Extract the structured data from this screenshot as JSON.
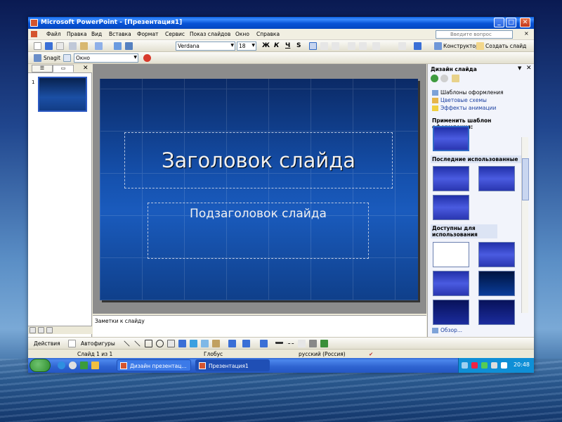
{
  "window": {
    "title": "Microsoft PowerPoint - [Презентация1]"
  },
  "menu": {
    "items": [
      "Файл",
      "Правка",
      "Вид",
      "Вставка",
      "Формат",
      "Сервис",
      "Показ слайдов",
      "Окно",
      "Справка"
    ],
    "help_placeholder": "Введите вопрос"
  },
  "toolbar": {
    "font": "Verdana",
    "size": "18",
    "bold": "Ж",
    "italic": "К",
    "underline": "Ч",
    "shadow": "S",
    "designer_label": "Конструктор",
    "new_slide_label": "Создать слайд",
    "snagit_label": "Snagit",
    "window_select": "Окно"
  },
  "slides_panel": {
    "slide_number": "1"
  },
  "slide": {
    "title": "Заголовок слайда",
    "subtitle": "Подзаголовок слайда"
  },
  "notes": {
    "placeholder": "Заметки к слайду"
  },
  "task_pane": {
    "title": "Дизайн слайда",
    "links": [
      "Шаблоны оформления",
      "Цветовые схемы",
      "Эффекты анимации"
    ],
    "apply_label": "Применить шаблон оформления:",
    "recent_label": "Последние использованные",
    "available_label": "Доступны для использования",
    "browse_label": "Обзор..."
  },
  "drawing": {
    "actions_label": "Действия",
    "autoshapes_label": "Автофигуры"
  },
  "status": {
    "slide": "Слайд 1 из 1",
    "design": "Глобус",
    "language": "русский (Россия)"
  },
  "taskbar": {
    "btn1": "Дизайн презентац...",
    "btn2": "Презентация1",
    "time": "20:48"
  },
  "colors": {
    "titlebar": "#0853d6",
    "slide_bg": "#1551ae",
    "taskbar": "#2e63d0"
  }
}
